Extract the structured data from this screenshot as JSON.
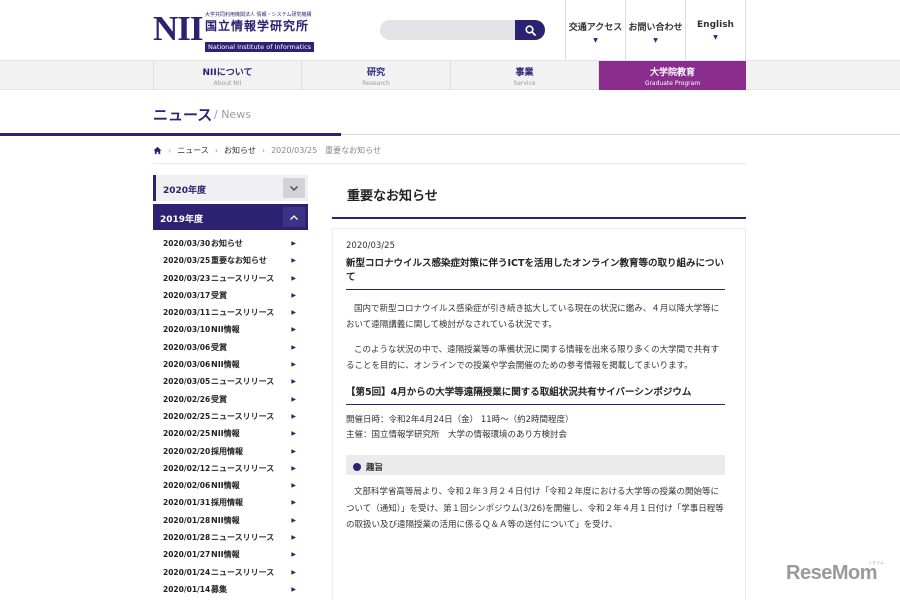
{
  "header": {
    "logo": {
      "mark": "NII",
      "small": "大学共同利用機関法人 情報・システム研究機構",
      "jp": "国立情報学研究所",
      "en": "National Institute of Informatics"
    },
    "search": {
      "placeholder": "",
      "icon": "search-icon"
    },
    "links": [
      {
        "label": "交通アクセス"
      },
      {
        "label": "お問い合わせ"
      },
      {
        "label": "English"
      }
    ]
  },
  "nav": [
    {
      "jp": "NIIについて",
      "en": "About NII"
    },
    {
      "jp": "研究",
      "en": "Research"
    },
    {
      "jp": "事業",
      "en": "Service"
    },
    {
      "jp": "大学院教育",
      "en": "Graduate Program"
    }
  ],
  "page": {
    "title": "ニュース",
    "title_en": "/ News"
  },
  "breadcrumb": {
    "home_icon": "home-icon",
    "items": [
      "ニュース",
      "お知らせ"
    ],
    "current": "2020/03/25　重要なお知らせ"
  },
  "sidebar": {
    "years": [
      {
        "label": "2020年度",
        "toggle": "chevron-down-icon"
      },
      {
        "label": "2019年度",
        "toggle": "chevron-up-icon"
      }
    ],
    "items": [
      {
        "date": "2020/03/30",
        "category": "お知らせ"
      },
      {
        "date": "2020/03/25",
        "category": "重要なお知らせ"
      },
      {
        "date": "2020/03/23",
        "category": "ニュースリリース"
      },
      {
        "date": "2020/03/17",
        "category": "受賞"
      },
      {
        "date": "2020/03/11",
        "category": "ニュースリリース"
      },
      {
        "date": "2020/03/10",
        "category": "NII情報"
      },
      {
        "date": "2020/03/06",
        "category": "受賞"
      },
      {
        "date": "2020/03/06",
        "category": "NII情報"
      },
      {
        "date": "2020/03/05",
        "category": "ニュースリリース"
      },
      {
        "date": "2020/02/26",
        "category": "受賞"
      },
      {
        "date": "2020/02/25",
        "category": "ニュースリリース"
      },
      {
        "date": "2020/02/25",
        "category": "NII情報"
      },
      {
        "date": "2020/02/20",
        "category": "採用情報"
      },
      {
        "date": "2020/02/12",
        "category": "ニュースリリース"
      },
      {
        "date": "2020/02/06",
        "category": "NII情報"
      },
      {
        "date": "2020/01/31",
        "category": "採用情報"
      },
      {
        "date": "2020/01/28",
        "category": "NII情報"
      },
      {
        "date": "2020/01/28",
        "category": "ニュースリリース"
      },
      {
        "date": "2020/01/27",
        "category": "NII情報"
      },
      {
        "date": "2020/01/24",
        "category": "ニュースリリース"
      },
      {
        "date": "2020/01/14",
        "category": "募集"
      }
    ]
  },
  "main": {
    "heading": "重要なお知らせ",
    "article": {
      "date": "2020/03/25",
      "title": "新型コロナウイルス感染症対策に伴うICTを活用したオンライン教育等の取り組みについて",
      "paragraphs": [
        "国内で新型コロナウイルス感染症が引き続き拡大している現在の状況に鑑み、４月以降大学等において遠隔講義に関して検討がなされている状況です。",
        "このような状況の中で、遠隔授業等の準備状況に関する情報を出来る限り多くの大学間で共有することを目的に、オンラインでの授業や学会開催のための参考情報を掲載してまいります。"
      ],
      "section_title": "【第5回】4月からの大学等遠隔授業に関する取組状況共有サイバーシンポジウム",
      "event_date": "開催日時：令和2年4月24日（金） 11時～（約2時間程度）",
      "organizer": "主催：国立情報学研究所　大学の情報環境のあり方検討会",
      "band_label": "趣旨",
      "band_paragraph": "文部科学省高等局より、令和２年３月２４日付け「令和２年度における大学等の授業の開始等について（通知）」を受け、第１回シンポジウム(3/26)を開催し、令和２年４月１日付け「学事日程等の取扱い及び遠隔授業の活用に係るＱ＆Ａ等の送付について」を受け、"
    }
  },
  "watermark": {
    "text": "ReseMom",
    "kana": "リセマム"
  },
  "colors": {
    "primary": "#2b2272",
    "active_nav": "#8a2d8d",
    "nav_bg": "#f2f2f3"
  }
}
